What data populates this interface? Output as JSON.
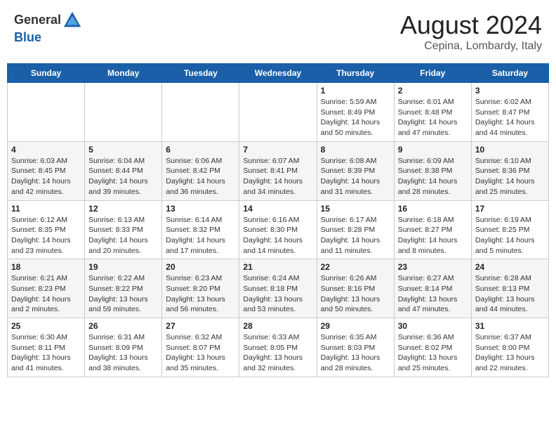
{
  "header": {
    "logo_line1": "General",
    "logo_line2": "Blue",
    "month": "August 2024",
    "location": "Cepina, Lombardy, Italy"
  },
  "weekdays": [
    "Sunday",
    "Monday",
    "Tuesday",
    "Wednesday",
    "Thursday",
    "Friday",
    "Saturday"
  ],
  "weeks": [
    [
      {
        "day": "",
        "info": ""
      },
      {
        "day": "",
        "info": ""
      },
      {
        "day": "",
        "info": ""
      },
      {
        "day": "",
        "info": ""
      },
      {
        "day": "1",
        "info": "Sunrise: 5:59 AM\nSunset: 8:49 PM\nDaylight: 14 hours\nand 50 minutes."
      },
      {
        "day": "2",
        "info": "Sunrise: 6:01 AM\nSunset: 8:48 PM\nDaylight: 14 hours\nand 47 minutes."
      },
      {
        "day": "3",
        "info": "Sunrise: 6:02 AM\nSunset: 8:47 PM\nDaylight: 14 hours\nand 44 minutes."
      }
    ],
    [
      {
        "day": "4",
        "info": "Sunrise: 6:03 AM\nSunset: 8:45 PM\nDaylight: 14 hours\nand 42 minutes."
      },
      {
        "day": "5",
        "info": "Sunrise: 6:04 AM\nSunset: 8:44 PM\nDaylight: 14 hours\nand 39 minutes."
      },
      {
        "day": "6",
        "info": "Sunrise: 6:06 AM\nSunset: 8:42 PM\nDaylight: 14 hours\nand 36 minutes."
      },
      {
        "day": "7",
        "info": "Sunrise: 6:07 AM\nSunset: 8:41 PM\nDaylight: 14 hours\nand 34 minutes."
      },
      {
        "day": "8",
        "info": "Sunrise: 6:08 AM\nSunset: 8:39 PM\nDaylight: 14 hours\nand 31 minutes."
      },
      {
        "day": "9",
        "info": "Sunrise: 6:09 AM\nSunset: 8:38 PM\nDaylight: 14 hours\nand 28 minutes."
      },
      {
        "day": "10",
        "info": "Sunrise: 6:10 AM\nSunset: 8:36 PM\nDaylight: 14 hours\nand 25 minutes."
      }
    ],
    [
      {
        "day": "11",
        "info": "Sunrise: 6:12 AM\nSunset: 8:35 PM\nDaylight: 14 hours\nand 23 minutes."
      },
      {
        "day": "12",
        "info": "Sunrise: 6:13 AM\nSunset: 8:33 PM\nDaylight: 14 hours\nand 20 minutes."
      },
      {
        "day": "13",
        "info": "Sunrise: 6:14 AM\nSunset: 8:32 PM\nDaylight: 14 hours\nand 17 minutes."
      },
      {
        "day": "14",
        "info": "Sunrise: 6:16 AM\nSunset: 8:30 PM\nDaylight: 14 hours\nand 14 minutes."
      },
      {
        "day": "15",
        "info": "Sunrise: 6:17 AM\nSunset: 8:28 PM\nDaylight: 14 hours\nand 11 minutes."
      },
      {
        "day": "16",
        "info": "Sunrise: 6:18 AM\nSunset: 8:27 PM\nDaylight: 14 hours\nand 8 minutes."
      },
      {
        "day": "17",
        "info": "Sunrise: 6:19 AM\nSunset: 8:25 PM\nDaylight: 14 hours\nand 5 minutes."
      }
    ],
    [
      {
        "day": "18",
        "info": "Sunrise: 6:21 AM\nSunset: 8:23 PM\nDaylight: 14 hours\nand 2 minutes."
      },
      {
        "day": "19",
        "info": "Sunrise: 6:22 AM\nSunset: 8:22 PM\nDaylight: 13 hours\nand 59 minutes."
      },
      {
        "day": "20",
        "info": "Sunrise: 6:23 AM\nSunset: 8:20 PM\nDaylight: 13 hours\nand 56 minutes."
      },
      {
        "day": "21",
        "info": "Sunrise: 6:24 AM\nSunset: 8:18 PM\nDaylight: 13 hours\nand 53 minutes."
      },
      {
        "day": "22",
        "info": "Sunrise: 6:26 AM\nSunset: 8:16 PM\nDaylight: 13 hours\nand 50 minutes."
      },
      {
        "day": "23",
        "info": "Sunrise: 6:27 AM\nSunset: 8:14 PM\nDaylight: 13 hours\nand 47 minutes."
      },
      {
        "day": "24",
        "info": "Sunrise: 6:28 AM\nSunset: 8:13 PM\nDaylight: 13 hours\nand 44 minutes."
      }
    ],
    [
      {
        "day": "25",
        "info": "Sunrise: 6:30 AM\nSunset: 8:11 PM\nDaylight: 13 hours\nand 41 minutes."
      },
      {
        "day": "26",
        "info": "Sunrise: 6:31 AM\nSunset: 8:09 PM\nDaylight: 13 hours\nand 38 minutes."
      },
      {
        "day": "27",
        "info": "Sunrise: 6:32 AM\nSunset: 8:07 PM\nDaylight: 13 hours\nand 35 minutes."
      },
      {
        "day": "28",
        "info": "Sunrise: 6:33 AM\nSunset: 8:05 PM\nDaylight: 13 hours\nand 32 minutes."
      },
      {
        "day": "29",
        "info": "Sunrise: 6:35 AM\nSunset: 8:03 PM\nDaylight: 13 hours\nand 28 minutes."
      },
      {
        "day": "30",
        "info": "Sunrise: 6:36 AM\nSunset: 8:02 PM\nDaylight: 13 hours\nand 25 minutes."
      },
      {
        "day": "31",
        "info": "Sunrise: 6:37 AM\nSunset: 8:00 PM\nDaylight: 13 hours\nand 22 minutes."
      }
    ]
  ]
}
